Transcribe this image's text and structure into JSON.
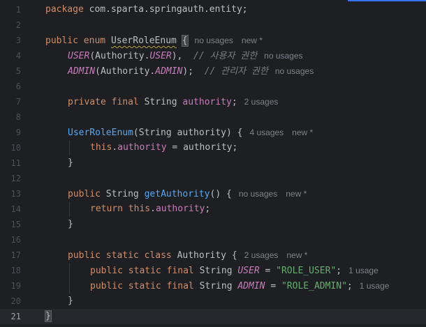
{
  "editor": {
    "accent_color": "#3574f0",
    "current_line": "21",
    "lines": [
      {
        "number": "1",
        "text": "package com.sparta.springauth.entity;"
      },
      {
        "number": "2",
        "text": ""
      },
      {
        "number": "3",
        "text": "public enum UserRoleEnum {",
        "hints": [
          "no usages",
          "new *"
        ]
      },
      {
        "number": "4",
        "text": "USER(Authority.USER),  // 사용자 권한",
        "hints": [
          "no usages"
        ]
      },
      {
        "number": "5",
        "text": "ADMIN(Authority.ADMIN);  // 관리자 권한",
        "hints": [
          "no usages"
        ]
      },
      {
        "number": "6",
        "text": ""
      },
      {
        "number": "7",
        "text": "private final String authority;",
        "hints": [
          "2 usages"
        ]
      },
      {
        "number": "8",
        "text": ""
      },
      {
        "number": "9",
        "text": "UserRoleEnum(String authority) {",
        "hints": [
          "4 usages",
          "new *"
        ]
      },
      {
        "number": "10",
        "text": "this.authority = authority;"
      },
      {
        "number": "11",
        "text": "}"
      },
      {
        "number": "12",
        "text": ""
      },
      {
        "number": "13",
        "text": "public String getAuthority() {",
        "hints": [
          "no usages",
          "new *"
        ]
      },
      {
        "number": "14",
        "text": "return this.authority;"
      },
      {
        "number": "15",
        "text": "}"
      },
      {
        "number": "16",
        "text": ""
      },
      {
        "number": "17",
        "text": "public static class Authority {",
        "hints": [
          "2 usages",
          "new *"
        ]
      },
      {
        "number": "18",
        "text": "public static final String USER = \"ROLE_USER\";",
        "hints": [
          "1 usage"
        ]
      },
      {
        "number": "19",
        "text": "public static final String ADMIN = \"ROLE_ADMIN\";",
        "hints": [
          "1 usage"
        ]
      },
      {
        "number": "20",
        "text": "}"
      },
      {
        "number": "21",
        "text": "}"
      }
    ]
  },
  "tokens": {
    "package_kw": "package",
    "package_name": " com.sparta.springauth.entity;",
    "public_kw": "public",
    "enum_kw": "enum",
    "enum_name": "UserRoleEnum",
    "open_brace": "{",
    "close_brace": "}",
    "user_const": "USER",
    "admin_const": "ADMIN",
    "authority_cls": "Authority",
    "paren_open": "(",
    "dot": ".",
    "user_end": "),",
    "admin_end": ");",
    "comment_user": "// 사용자 권한",
    "comment_admin": "// 관리자 권한",
    "private_kw": "private",
    "final_kw": "final",
    "string_type": "String",
    "authority_field": "authority",
    "semicolon": ";",
    "ctor_name": "UserRoleEnum",
    "ctor_params": "(String authority) {",
    "this_kw": "this",
    "assign_rhs": " = authority;",
    "getter_name": "getAuthority",
    "getter_parens": "() {",
    "return_kw": "return",
    "static_kw": "static",
    "class_kw": "class",
    "user_value": "\"ROLE_USER\"",
    "admin_value": "\"ROLE_ADMIN\"",
    "eq": " = "
  }
}
